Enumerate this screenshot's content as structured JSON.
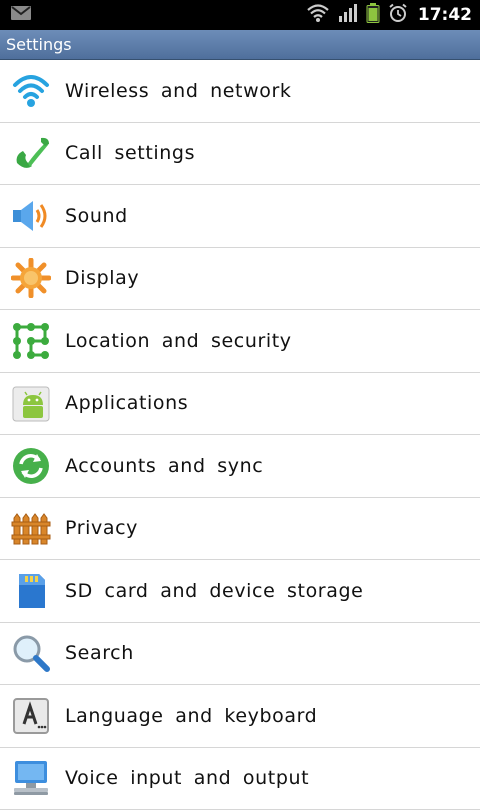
{
  "status_bar": {
    "time": "17:42",
    "icons": [
      "mail-icon",
      "wifi-icon",
      "signal-icon",
      "battery-icon",
      "alarm-icon"
    ]
  },
  "header": {
    "title": "Settings"
  },
  "colors": {
    "title_bar": "#5b7aa8",
    "status_bar": "#000000",
    "divider": "#d6d6d6"
  },
  "settings": {
    "items": [
      {
        "label": "Wireless and network",
        "icon": "wifi-icon"
      },
      {
        "label": "Call settings",
        "icon": "phone-icon"
      },
      {
        "label": "Sound",
        "icon": "speaker-icon"
      },
      {
        "label": "Display",
        "icon": "sun-icon"
      },
      {
        "label": "Location and security",
        "icon": "pattern-lock-icon"
      },
      {
        "label": "Applications",
        "icon": "android-icon"
      },
      {
        "label": "Accounts and sync",
        "icon": "sync-icon"
      },
      {
        "label": "Privacy",
        "icon": "fence-icon"
      },
      {
        "label": "SD card and device storage",
        "icon": "sd-card-icon"
      },
      {
        "label": "Search",
        "icon": "magnifier-icon"
      },
      {
        "label": "Language and keyboard",
        "icon": "keyboard-key-icon"
      },
      {
        "label": "Voice input and output",
        "icon": "monitor-icon"
      }
    ]
  }
}
